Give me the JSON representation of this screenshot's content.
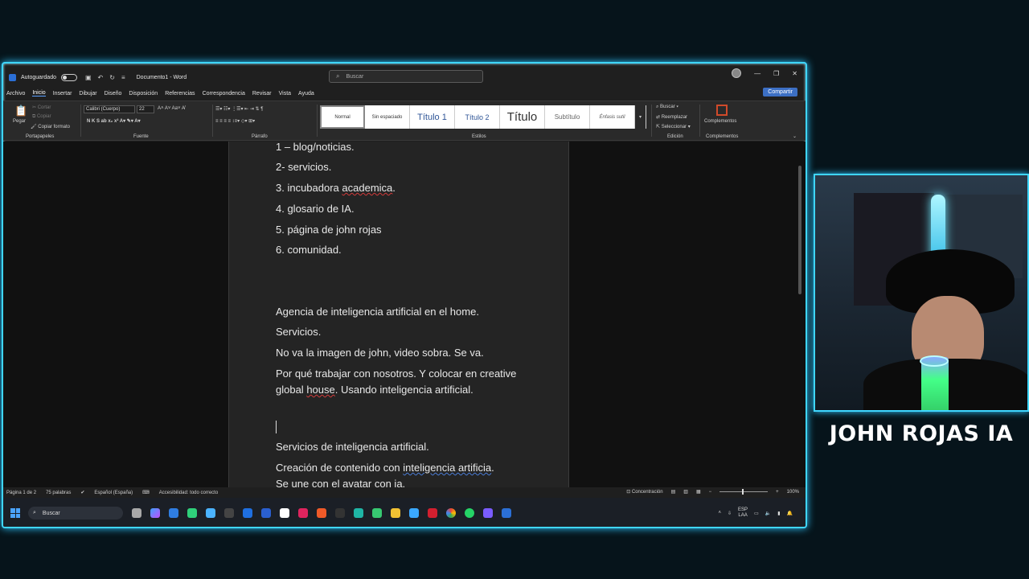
{
  "window": {
    "autosave_label": "Autoguardado",
    "document_title": "Documento1 - Word",
    "search_placeholder": "Buscar"
  },
  "menu": {
    "items": [
      "Archivo",
      "Inicio",
      "Insertar",
      "Dibujar",
      "Diseño",
      "Disposición",
      "Referencias",
      "Correspondencia",
      "Revisar",
      "Vista",
      "Ayuda"
    ],
    "active": "Inicio",
    "share_button": "Compartir"
  },
  "ribbon": {
    "clipboard": {
      "paste": "Pegar",
      "cut": "Cortar",
      "copy": "Copiar",
      "format_painter": "Copiar formato",
      "label": "Portapapeles"
    },
    "font": {
      "family": "Calibri (Cuerpo)",
      "size": "22",
      "label": "Fuente"
    },
    "paragraph": {
      "label": "Párrafo"
    },
    "styles": {
      "items": [
        "Normal",
        "Sin espaciado",
        "Título 1",
        "Título 2",
        "Título",
        "Subtítulo",
        "Énfasis sutil"
      ],
      "label": "Estilos"
    },
    "editing": {
      "find": "Buscar",
      "replace": "Reemplazar",
      "select": "Seleccionar",
      "label": "Edición"
    },
    "addins": {
      "button": "Complementos",
      "label": "Complementos"
    }
  },
  "document": {
    "lines": [
      "1 – blog/noticias.",
      "2- servicios.",
      "3. incubadora academica.",
      "4. glosario de IA.",
      "5. página de john rojas",
      "6. comunidad.",
      "Agencia de inteligencia artificial en el home.",
      "Servicios.",
      "No va la imagen de john, video sobra. Se va.",
      "Por qué trabajar con nosotros. Y colocar en creative global house.  Usando inteligencia artificial.",
      "Servicios de inteligencia artificial.",
      "Creación de contenido con inteligencia  artificia.",
      "Se une con el avatar con ia."
    ]
  },
  "status": {
    "page": "Página 1 de 2",
    "words": "75 palabras",
    "language": "Español (España)",
    "accessibility": "Accesibilidad: todo correcto",
    "focus": "Concentración",
    "zoom": "100%"
  },
  "taskbar": {
    "search": "Buscar",
    "lang_top": "ESP",
    "lang_bottom": "LAA"
  },
  "overlay": {
    "name": "JOHN ROJAS IA"
  }
}
